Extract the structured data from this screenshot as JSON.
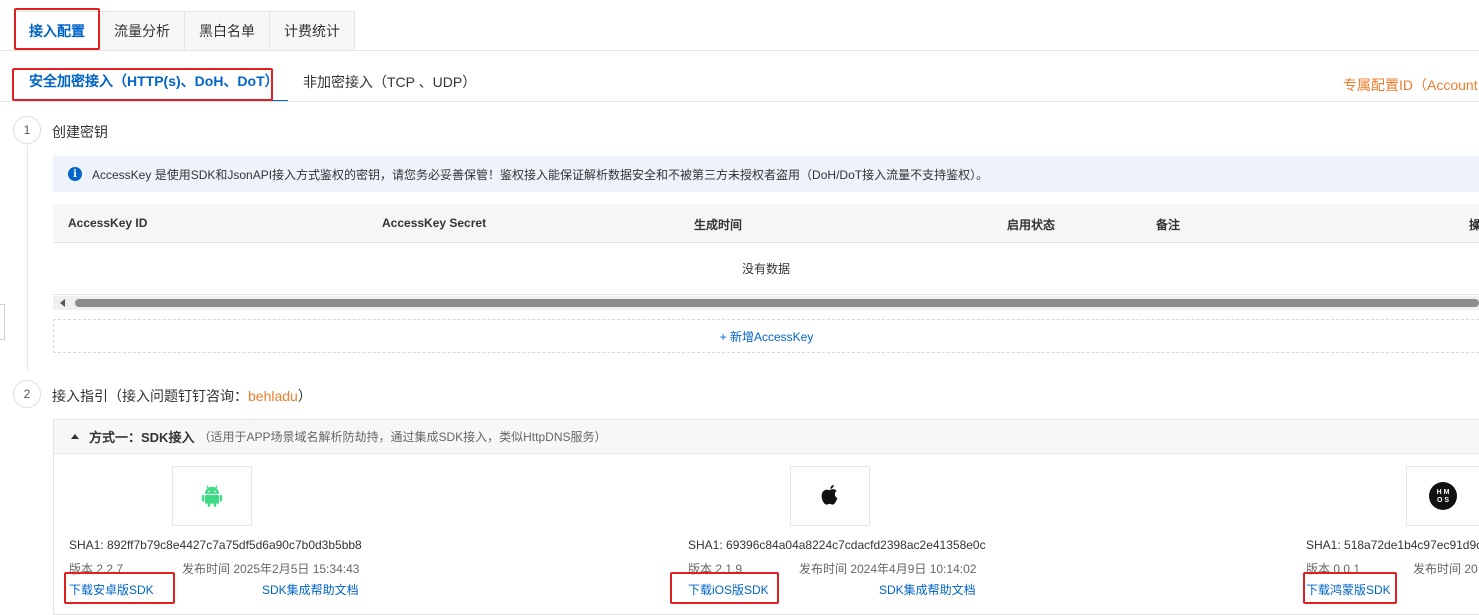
{
  "top_tabs": [
    {
      "label": "接入配置",
      "active": true
    },
    {
      "label": "流量分析",
      "active": false
    },
    {
      "label": "黑白名单",
      "active": false
    },
    {
      "label": "计费统计",
      "active": false
    }
  ],
  "sub_tabs": [
    {
      "label": "安全加密接入（HTTP(s)、DoH、DoT）",
      "active": true
    },
    {
      "label": "非加密接入（TCP 、UDP）",
      "active": false
    }
  ],
  "exclusive_id_label": "专属配置ID（Account",
  "step1": {
    "number": "1",
    "title": "创建密钥",
    "info": "AccessKey 是使用SDK和JsonAPI接入方式鉴权的密钥，请您务必妥善保管！鉴权接入能保证解析数据安全和不被第三方未授权者盗用（DoH/DoT接入流量不支持鉴权）。",
    "table": {
      "columns": [
        "AccessKey ID",
        "AccessKey Secret",
        "生成时间",
        "启用状态",
        "备注",
        "操"
      ],
      "empty_text": "没有数据"
    },
    "add_button": "+ 新增AccessKey"
  },
  "step2": {
    "number": "2",
    "title_prefix": "接入指引（接入问题钉钉咨询：",
    "contact": "behladu",
    "title_suffix": "）",
    "method1": {
      "title": "方式一：SDK接入",
      "note": "（适用于APP场景域名解析防劫持，通过集成SDK接入，类似HttpDNS服务）"
    },
    "sdks": [
      {
        "icon": "android-icon",
        "sha": "SHA1: 892ff7b79c8e4427c7a75df5d6a90c7b0d3b5bb8",
        "version": "版本 2.2.7",
        "date": "发布时间 2025年2月5日 15:34:43",
        "download": "下载安卓版SDK",
        "doc": "SDK集成帮助文档"
      },
      {
        "icon": "apple-icon",
        "sha": "SHA1: 69396c84a04a8224c7cdacfd2398ac2e41358e0c",
        "version": "版本 2.1.9",
        "date": "发布时间 2024年4月9日 10:14:02",
        "download": "下载iOS版SDK",
        "doc": "SDK集成帮助文档"
      },
      {
        "icon": "harmonyos-icon",
        "icon_text": "H M\nO S",
        "sha": "SHA1: 518a72de1b4c97ec91d9cf",
        "version": "版本 0.0.1",
        "date": "发布时间 20",
        "download": "下载鸿蒙版SDK",
        "doc": ""
      }
    ]
  },
  "colors": {
    "primary": "#0064c8",
    "accent_orange": "#f07c2c",
    "highlight_red": "#e02020",
    "android_green": "#3ddc84"
  }
}
